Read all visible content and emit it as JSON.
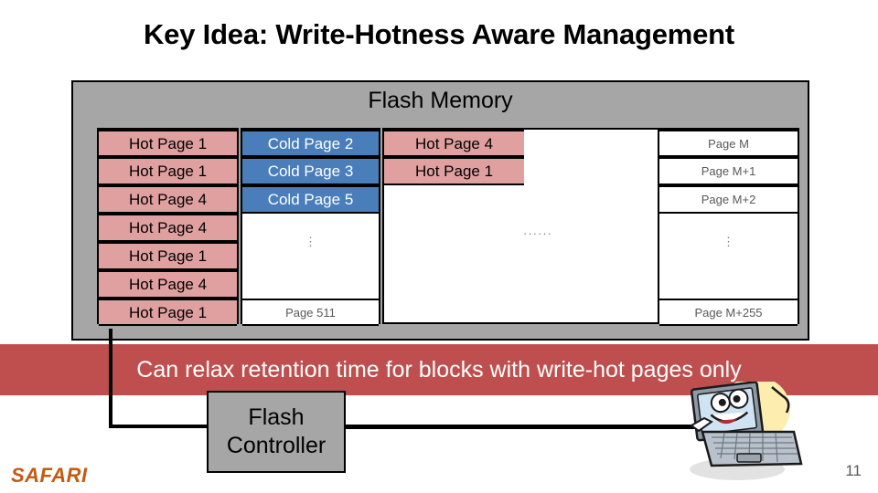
{
  "slide": {
    "title": "Key Idea: Write-Hotness Aware Management",
    "number": "11",
    "logo": "SAFARI"
  },
  "flash_memory": {
    "title": "Flash Memory",
    "blocks": [
      {
        "name": "block-hot",
        "rows": [
          {
            "label": "Hot Page 1",
            "kind": "hot"
          },
          {
            "label": "Hot Page 1",
            "kind": "hot"
          },
          {
            "label": "Hot Page 4",
            "kind": "hot"
          },
          {
            "label": "Hot Page 4",
            "kind": "hot"
          },
          {
            "label": "Hot Page 1",
            "kind": "hot"
          },
          {
            "label": "Hot Page 4",
            "kind": "hot"
          },
          {
            "label": "Hot Page 1",
            "kind": "hot"
          }
        ]
      },
      {
        "name": "block-cold",
        "rows": [
          {
            "label": "Cold Page 2",
            "kind": "cold"
          },
          {
            "label": "Cold Page 3",
            "kind": "cold"
          },
          {
            "label": "Cold Page 5",
            "kind": "cold"
          }
        ],
        "vertical_ellipsis": "⋮",
        "last_row": {
          "label": "Page 511",
          "kind": "plain"
        }
      },
      {
        "name": "block-mixed",
        "rows": [
          {
            "label": "Hot Page 4",
            "kind": "hot"
          },
          {
            "label": "Hot Page 1",
            "kind": "hot"
          }
        ],
        "horizontal_ellipsis": "······"
      },
      {
        "name": "block-plain",
        "rows": [
          {
            "label": "Page M",
            "kind": "plain"
          },
          {
            "label": "Page M+1",
            "kind": "plain"
          },
          {
            "label": "Page M+2",
            "kind": "plain"
          }
        ],
        "vertical_ellipsis": "⋮",
        "last_row": {
          "label": "Page M+255",
          "kind": "plain"
        }
      }
    ]
  },
  "callout": {
    "text": "Can relax retention time for blocks with write-hot pages only"
  },
  "controller": {
    "line1": "Flash",
    "line2": "Controller"
  },
  "colors": {
    "hot_page": "#e0a0a0",
    "cold_page": "#4a7ebb",
    "panel_gray": "#a6a6a6",
    "callout_red": "#bf4f4f",
    "logo_orange": "#c55a11"
  }
}
